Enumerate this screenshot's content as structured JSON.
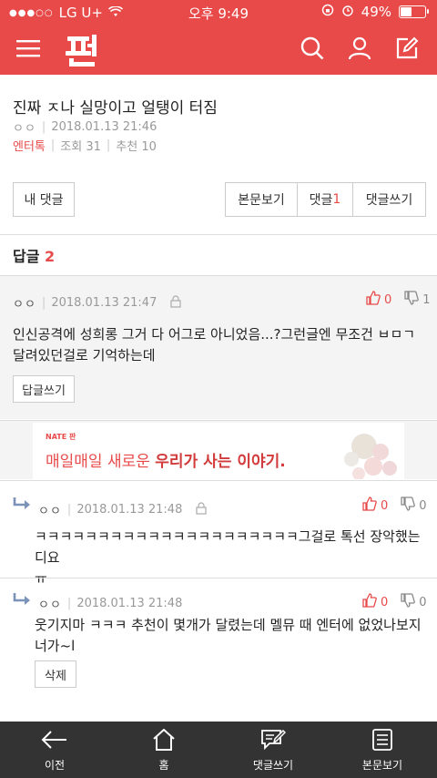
{
  "statusbar": {
    "carrier": "LG U+",
    "time": "오후 9:49",
    "battery": "49%",
    "battery_level": 0.49
  },
  "appbar": {
    "logo_text": "판"
  },
  "article": {
    "title": "진짜 ㅈ나 실망이고 얼탱이 터짐",
    "author": "ㅇㅇ",
    "date": "2018.01.13 21:46",
    "category": "엔터톡",
    "views": "조회 31",
    "recommend": "추천 10"
  },
  "actions": {
    "my_comments": "내 댓글",
    "view_post": "본문보기",
    "comments_label": "댓글",
    "comments_count": "1",
    "write_comment": "댓글쓰기"
  },
  "replies": {
    "label": "답글",
    "count": "2"
  },
  "comment": {
    "author": "ㅇㅇ",
    "date": "2018.01.13 21:47",
    "up": "0",
    "down": "1",
    "text_line1": "인신공격에 성희롱 그거 다 어그로 아니었음...?그런글엔 무조건 ㅂㅁㄱ",
    "text_line2": "달려있던걸로 기억하는데",
    "reply_button": "답글쓰기"
  },
  "ad": {
    "brand": "NATE  판",
    "text_prefix": "매일매일 새로운 ",
    "text_emph": "우리가 사는 이야기."
  },
  "reply1": {
    "author": "ㅇㅇ",
    "date": "2018.01.13 21:48",
    "up": "0",
    "down": "0",
    "text_line1": "ㅋㅋㅋㅋㅋㅋㅋㅋㅋㅋㅋㅋㅋㅋㅋㅋㅋㅋㅋㅋㅋ그걸로 톡선 장악했는디요",
    "text_line2": "ㅠ"
  },
  "reply2": {
    "author": "ㅇㅇ",
    "date": "2018.01.13 21:48",
    "up": "0",
    "down": "0",
    "text_line1": "웃기지마 ㅋㅋㅋ 추천이 몇개가 달렸는데 멜뮤 때 엔터에 없었나보지",
    "text_line2": "너가~l",
    "delete_button": "삭제"
  },
  "bottomnav": {
    "back": "이전",
    "home": "홈",
    "write": "댓글쓰기",
    "view": "본문보기"
  },
  "colors": {
    "brand": "#e84a4a",
    "nav_bg": "#333333"
  }
}
